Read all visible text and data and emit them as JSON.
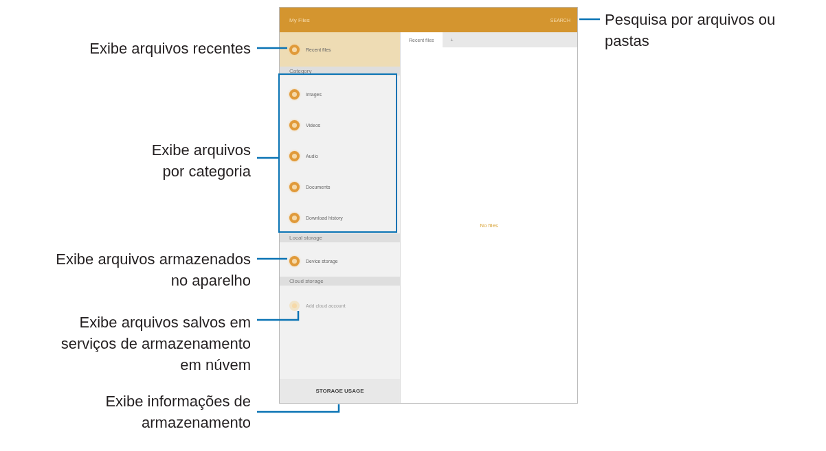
{
  "screen": {
    "app_bar": {
      "title": "My Files",
      "action": "SEARCH"
    },
    "sidebar": {
      "items": [
        {
          "kind": "item",
          "label": "Recent files",
          "selected": true,
          "disabled": false
        },
        {
          "kind": "header",
          "label": "Category"
        },
        {
          "kind": "item",
          "label": "Images",
          "selected": false,
          "disabled": false
        },
        {
          "kind": "item",
          "label": "Videos",
          "selected": false,
          "disabled": false
        },
        {
          "kind": "item",
          "label": "Audio",
          "selected": false,
          "disabled": false
        },
        {
          "kind": "item",
          "label": "Documents",
          "selected": false,
          "disabled": false
        },
        {
          "kind": "item",
          "label": "Download history",
          "selected": false,
          "disabled": false
        },
        {
          "kind": "header",
          "label": "Local storage"
        },
        {
          "kind": "item",
          "label": "Device storage",
          "selected": false,
          "disabled": false
        },
        {
          "kind": "header",
          "label": "Cloud storage"
        },
        {
          "kind": "item",
          "label": "Add cloud account",
          "selected": false,
          "disabled": true
        }
      ],
      "storage_button": "STORAGE USAGE"
    },
    "tabs": [
      {
        "label": "Recent files",
        "selected": true
      },
      {
        "label": "+",
        "selected": false
      }
    ],
    "empty_message": "No files"
  },
  "callouts": [
    {
      "text": "Pesquisa por arquivos ou\npastas"
    },
    {
      "text": "Exibe arquivos recentes"
    },
    {
      "text": "Exibe arquivos\npor categoria"
    },
    {
      "text": "Exibe arquivos armazenados\nno aparelho"
    },
    {
      "text": "Exibe arquivos salvos em\nserviços de armazenamento\nem núvem"
    },
    {
      "text": "Exibe informações de\narmazenamento"
    }
  ]
}
